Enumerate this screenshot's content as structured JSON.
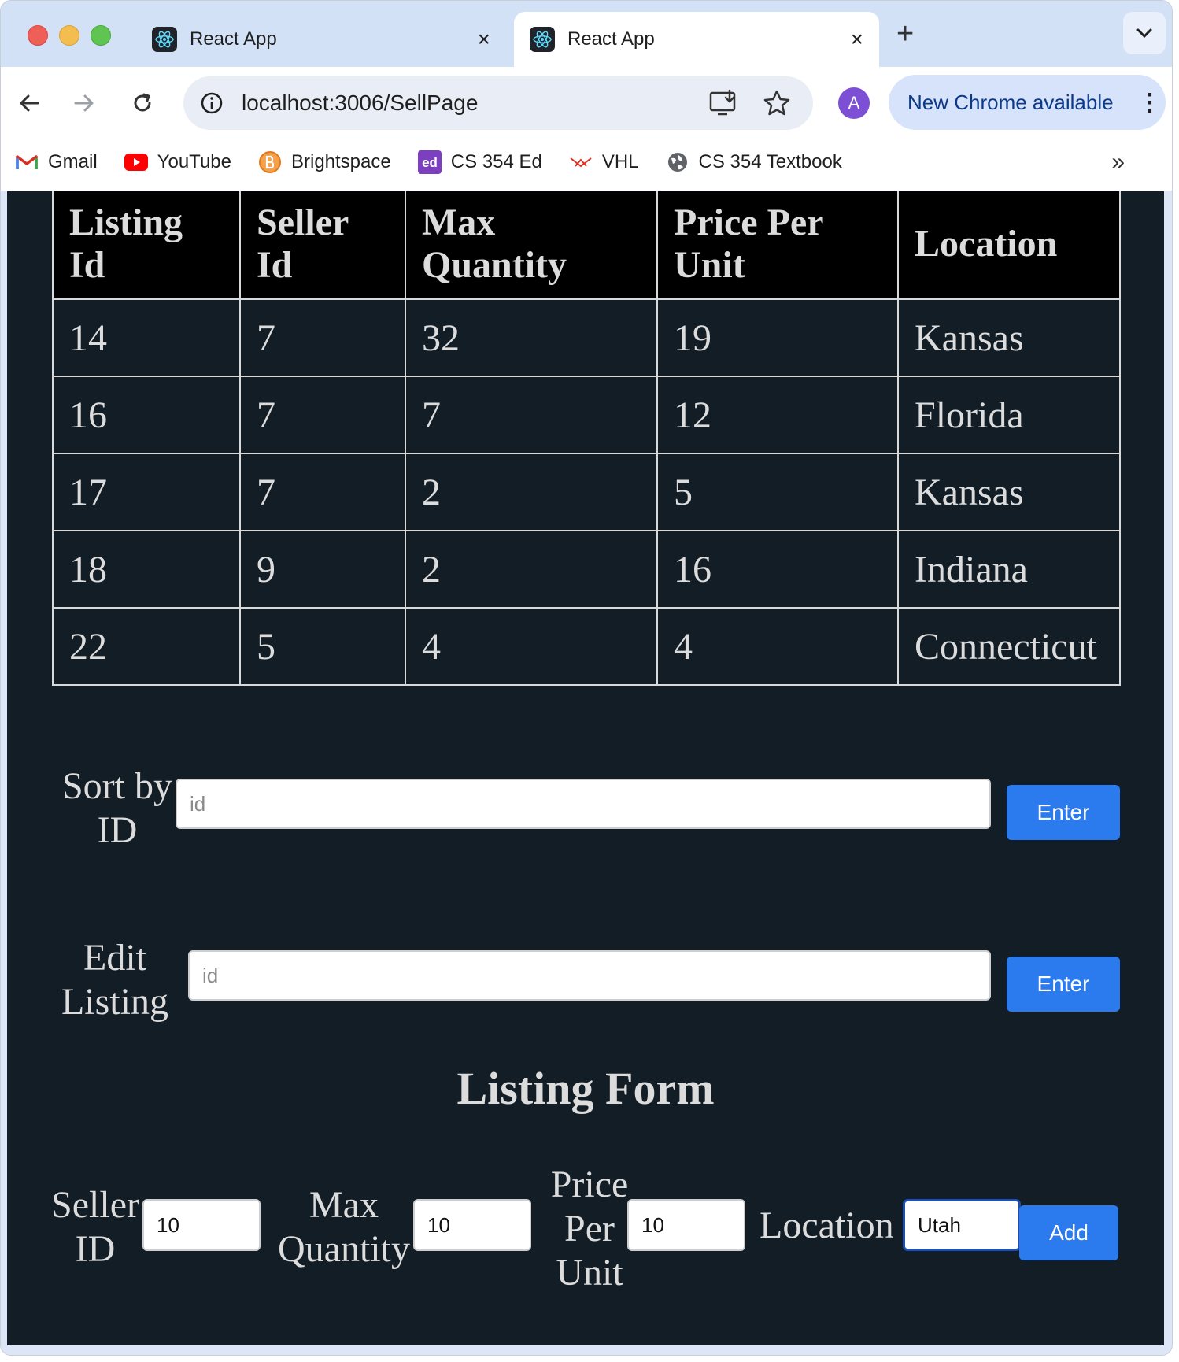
{
  "browser": {
    "tabs": [
      {
        "title": "React App",
        "close_icon": "×"
      },
      {
        "title": "React App",
        "close_icon": "×"
      }
    ],
    "new_tab_glyph": "+",
    "address": "localhost:3006/SellPage",
    "profile_initial": "A",
    "update_chip": "New Chrome available",
    "bookmarks": [
      {
        "label": "Gmail",
        "icon": "gmail-icon"
      },
      {
        "label": "YouTube",
        "icon": "youtube-icon"
      },
      {
        "label": "Brightspace",
        "icon": "brightspace-icon"
      },
      {
        "label": "CS 354 Ed",
        "icon": "ed-icon"
      },
      {
        "label": "VHL",
        "icon": "vhl-icon"
      },
      {
        "label": "CS 354 Textbook",
        "icon": "globe-icon"
      }
    ],
    "bookmarks_more": "»"
  },
  "table": {
    "headers": [
      "Listing Id",
      "Seller Id",
      "Max Quantity",
      "Price Per Unit",
      "Location"
    ],
    "rows": [
      [
        "14",
        "7",
        "32",
        "19",
        "Kansas"
      ],
      [
        "16",
        "7",
        "7",
        "12",
        "Florida"
      ],
      [
        "17",
        "7",
        "2",
        "5",
        "Kansas"
      ],
      [
        "18",
        "9",
        "2",
        "16",
        "Indiana"
      ],
      [
        "22",
        "5",
        "4",
        "4",
        "Connecticut"
      ]
    ]
  },
  "sort": {
    "label_line1": "Sort by",
    "label_line2": "ID",
    "placeholder": "id",
    "button": "Enter"
  },
  "edit": {
    "label_line1": "Edit",
    "label_line2": "Listing",
    "placeholder": "id",
    "button": "Enter"
  },
  "listing_form": {
    "heading": "Listing Form",
    "seller_label_1": "Seller",
    "seller_label_2": "ID",
    "seller_value": "10",
    "qty_label_1": "Max",
    "qty_label_2": "Quantity",
    "qty_value": "10",
    "price_label_1": "Price",
    "price_label_2": "Per",
    "price_label_3": "Unit",
    "price_value": "10",
    "location_label": "Location",
    "location_value": "Utah",
    "add_button": "Add"
  },
  "colors": {
    "page_bg": "#121d26",
    "header_bg": "#000000",
    "button_blue": "#2b7bef",
    "text": "#dcdcdc"
  }
}
